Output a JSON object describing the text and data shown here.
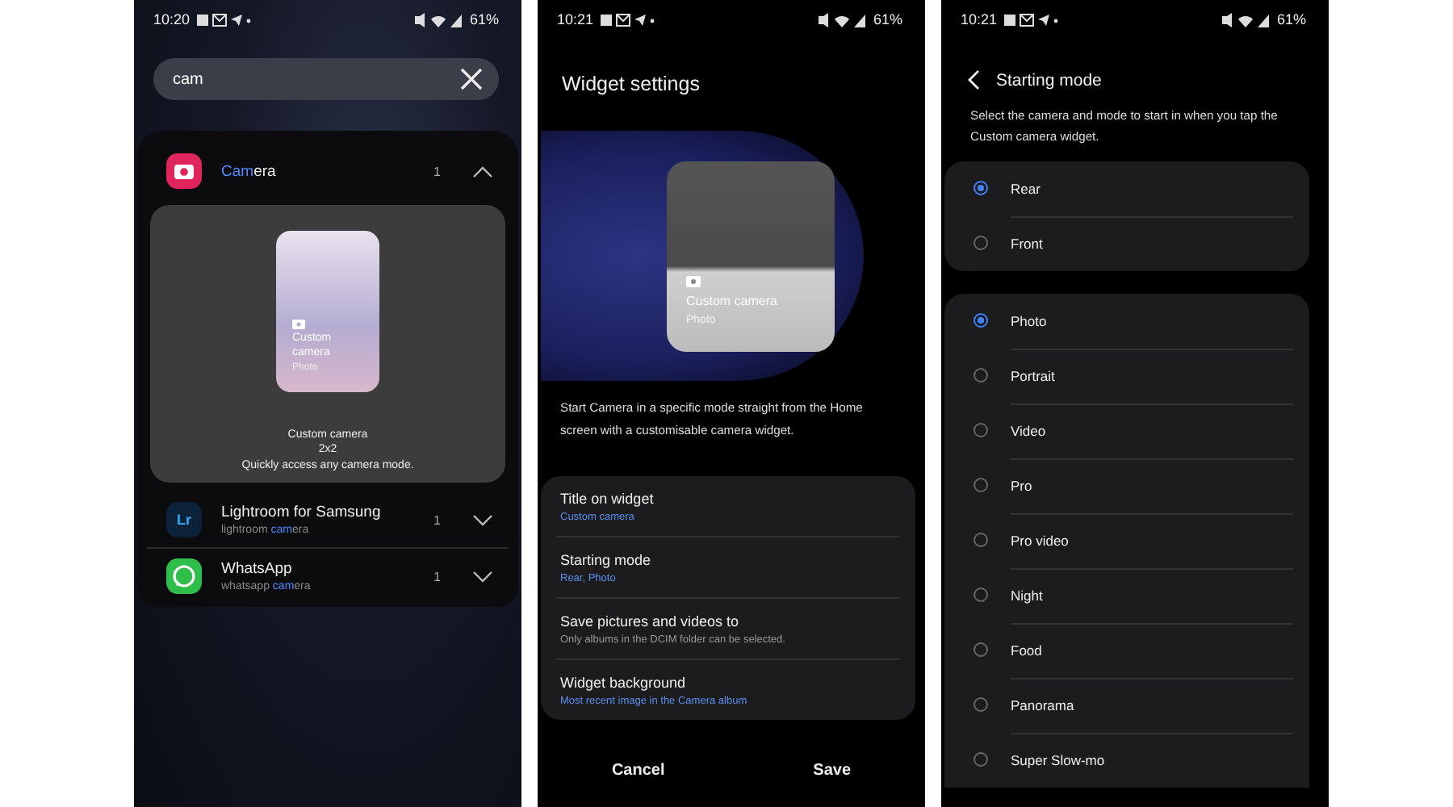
{
  "search_screen": {
    "status_bar": {
      "time": "10:20",
      "battery": "61%"
    },
    "search": {
      "value": "cam"
    },
    "results": [
      {
        "kind": "camera",
        "name": [
          {
            "text": "Cam",
            "match": true
          },
          {
            "text": "era",
            "match": false
          }
        ],
        "count": "1",
        "expanded": true,
        "widget": {
          "preview_title": "Custom camera",
          "preview_mode": "Photo",
          "name": "Custom camera",
          "size": "2x2",
          "description": "Quickly access any camera mode."
        }
      },
      {
        "kind": "lightroom",
        "icon_text": "Lr",
        "name": [
          {
            "text": "Lightroom for Samsung",
            "match": false
          }
        ],
        "sub": [
          {
            "text": "lightroom ",
            "match": false
          },
          {
            "text": "cam",
            "match": true
          },
          {
            "text": "era",
            "match": false
          }
        ],
        "count": "1",
        "expanded": false
      },
      {
        "kind": "whatsapp",
        "name": [
          {
            "text": "WhatsApp",
            "match": false
          }
        ],
        "sub": [
          {
            "text": "whatsapp ",
            "match": false
          },
          {
            "text": "cam",
            "match": true
          },
          {
            "text": "era",
            "match": false
          }
        ],
        "count": "1",
        "expanded": false
      }
    ]
  },
  "widget_settings_screen": {
    "status_bar": {
      "time": "10:21",
      "battery": "61%"
    },
    "title": "Widget settings",
    "preview": {
      "title": "Custom camera",
      "mode": "Photo"
    },
    "description": "Start Camera in a specific mode straight from the Home screen with a customisable camera widget.",
    "settings": [
      {
        "title": "Title on widget",
        "value": "Custom camera",
        "kind": "value"
      },
      {
        "title": "Starting mode",
        "value": "Rear, Photo",
        "kind": "value"
      },
      {
        "title": "Save pictures and videos to",
        "value": "Only albums in the DCIM folder can be selected.",
        "kind": "hint"
      },
      {
        "title": "Widget background",
        "value": "Most recent image in the Camera album",
        "kind": "value"
      }
    ],
    "buttons": [
      "Cancel",
      "Save"
    ]
  },
  "starting_mode_screen": {
    "status_bar": {
      "time": "10:21",
      "battery": "61%"
    },
    "title": "Starting mode",
    "description": "Select the camera and mode to start in when you tap the Custom camera widget.",
    "groups": [
      [
        {
          "label": "Rear",
          "selected": true
        },
        {
          "label": "Front",
          "selected": false
        }
      ],
      [
        {
          "label": "Photo",
          "selected": true
        },
        {
          "label": "Portrait",
          "selected": false
        },
        {
          "label": "Video",
          "selected": false
        },
        {
          "label": "Pro",
          "selected": false
        },
        {
          "label": "Pro video",
          "selected": false
        },
        {
          "label": "Night",
          "selected": false
        },
        {
          "label": "Food",
          "selected": false
        },
        {
          "label": "Panorama",
          "selected": false
        },
        {
          "label": "Super Slow-mo",
          "selected": false
        }
      ]
    ]
  }
}
